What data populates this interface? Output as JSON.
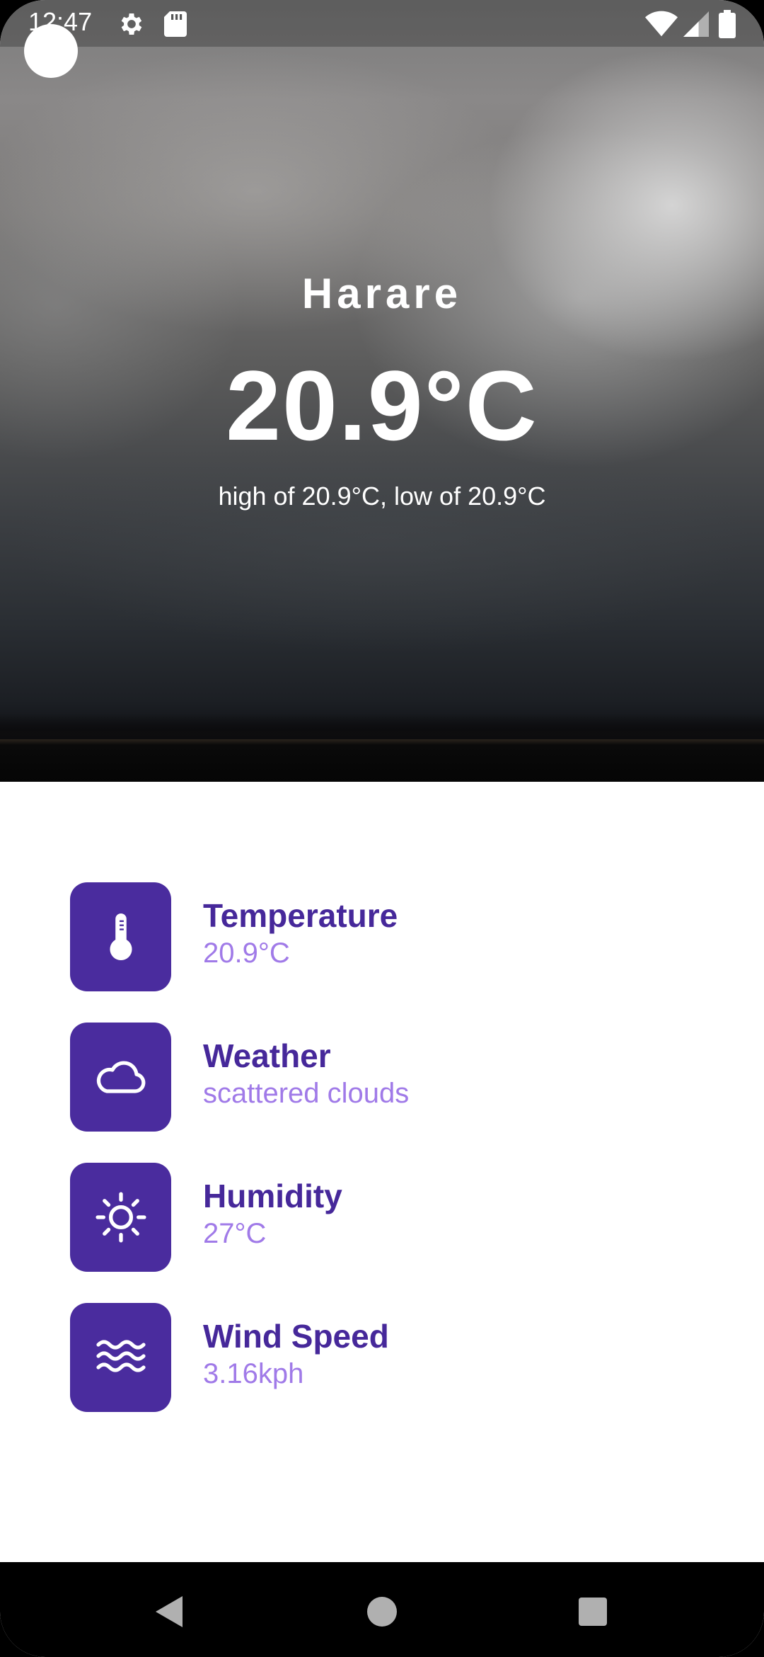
{
  "status_bar": {
    "time": "12:47",
    "icons": [
      "gear-icon",
      "sd-card-icon",
      "wifi-icon",
      "cell-signal-icon",
      "battery-icon"
    ]
  },
  "hero": {
    "city": "Harare",
    "temperature": "20.9°C",
    "high_low": "high of 20.9°C,  low of 20.9°C"
  },
  "details": [
    {
      "icon": "thermometer-icon",
      "title": "Temperature",
      "value": "20.9°C"
    },
    {
      "icon": "cloud-icon",
      "title": "Weather",
      "value": "scattered clouds"
    },
    {
      "icon": "sun-icon",
      "title": "Humidity",
      "value": "27°C"
    },
    {
      "icon": "waves-icon",
      "title": "Wind Speed",
      "value": "3.16kph"
    }
  ],
  "colors": {
    "tile_background": "#4a2c9e",
    "title_text": "#46289a",
    "value_text": "#a07ae8",
    "hero_text": "#ffffff"
  },
  "nav_bar": {
    "buttons": [
      "back-icon",
      "home-icon",
      "recents-icon"
    ]
  }
}
